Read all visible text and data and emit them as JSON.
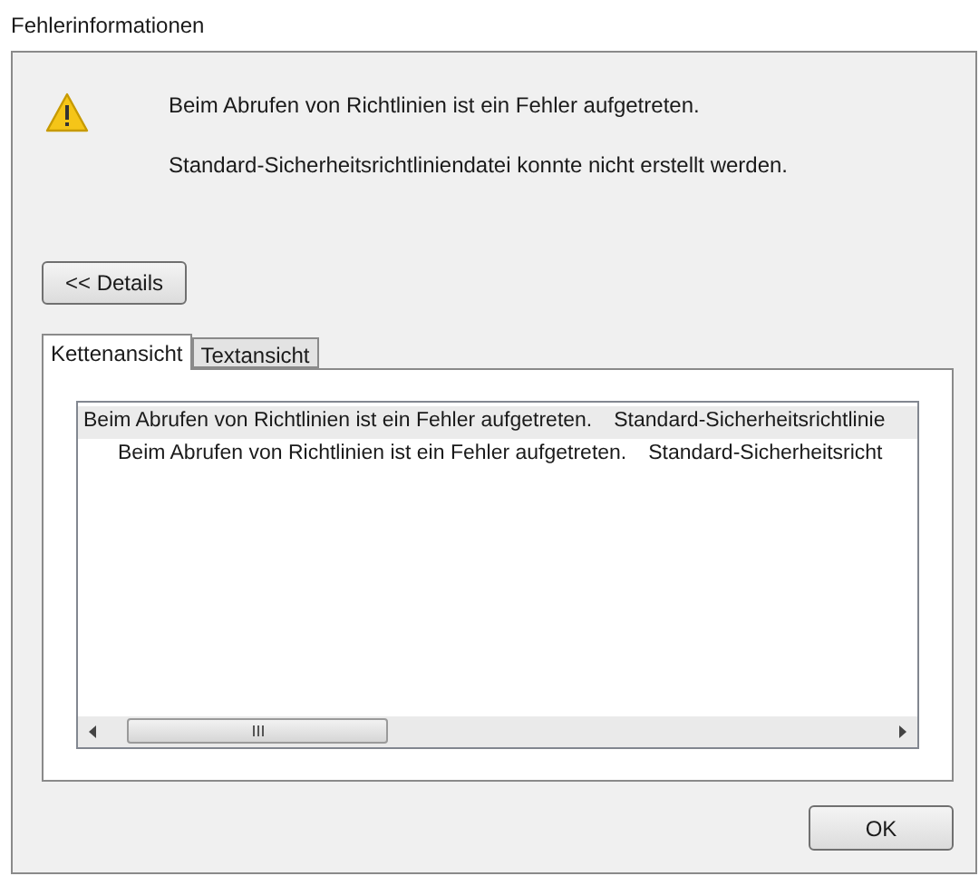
{
  "window": {
    "title": "Fehlerinformationen"
  },
  "messages": [
    "Beim Abrufen von Richtlinien ist ein Fehler aufgetreten.",
    "Standard-Sicherheitsrichtliniendatei konnte nicht erstellt werden."
  ],
  "details_button": "<< Details",
  "tabs": [
    {
      "label": "Kettenansicht",
      "selected": true
    },
    {
      "label": "Textansicht",
      "selected": false
    }
  ],
  "chain": [
    {
      "message": "Beim Abrufen von Richtlinien ist ein Fehler aufgetreten.",
      "detail": "Standard-Sicherheitsrichtlinie",
      "selected": true,
      "children": [
        {
          "message": "Beim Abrufen von Richtlinien ist ein Fehler aufgetreten.",
          "detail": "Standard-Sicherheitsricht",
          "selected": false
        }
      ]
    }
  ],
  "buttons": [
    "OK"
  ]
}
